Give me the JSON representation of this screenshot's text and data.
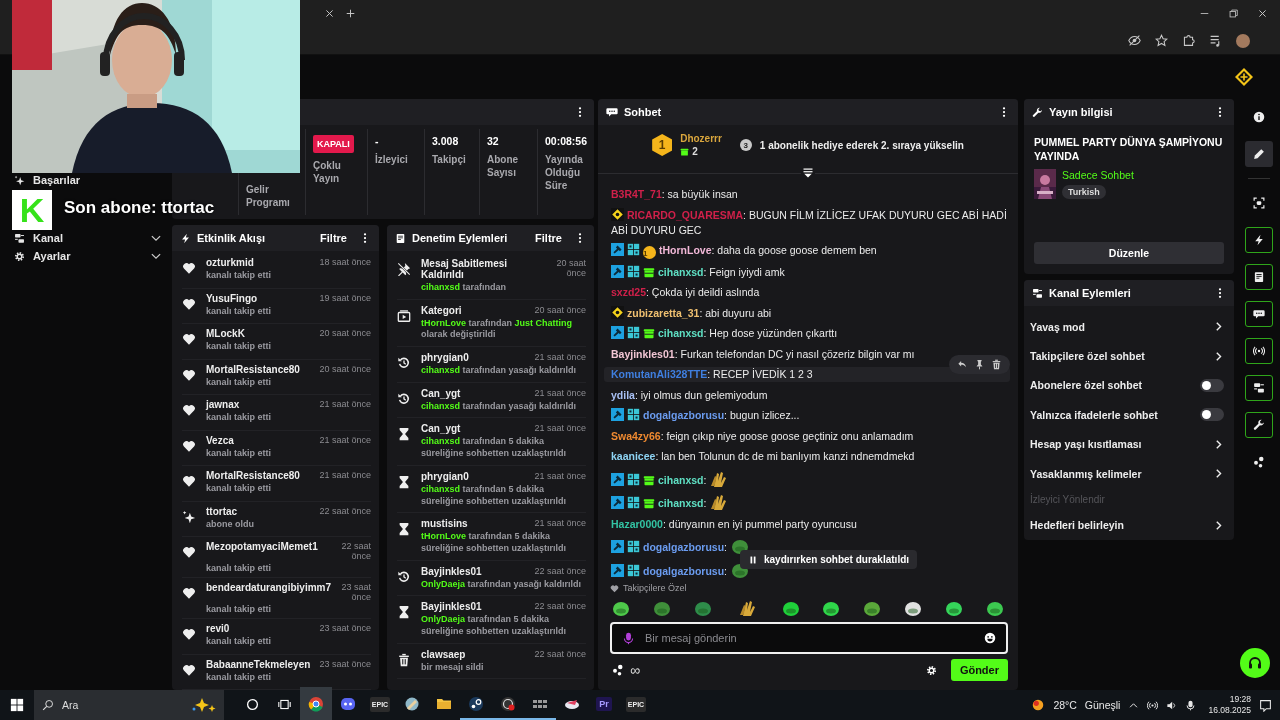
{
  "stream_overlay": {
    "logo": "K",
    "text": "Son abone: ttortac"
  },
  "sidebar": {
    "items": [
      {
        "label": "Başarılar",
        "expandable": false
      },
      {
        "label": "Kanal",
        "expandable": true
      },
      {
        "label": "Ayarlar",
        "expandable": true
      }
    ]
  },
  "stats": {
    "cells": [
      {
        "kind": "blank"
      },
      {
        "kind": "stat",
        "label": "Gelir Programı"
      },
      {
        "kind": "badge",
        "value": "KAPALI",
        "label": "Çoklu Yayın"
      },
      {
        "kind": "stat",
        "value": "-",
        "label": "İzleyici"
      },
      {
        "kind": "stat",
        "value": "3.008",
        "label": "Takipçi"
      },
      {
        "kind": "stat",
        "value": "32",
        "label": "Abone Sayısı"
      },
      {
        "kind": "stat",
        "value": "00:08:56",
        "label": "Yayında Olduğu Süre"
      }
    ]
  },
  "activity_feed": {
    "title": "Etkinlik Akışı",
    "filter": "Filtre",
    "items": [
      {
        "kind": "follow",
        "user": "ozturkmid",
        "action": "kanalı takip etti",
        "time": "18 saat önce"
      },
      {
        "kind": "follow",
        "user": "YusuFingo",
        "action": "kanalı takip etti",
        "time": "19 saat önce"
      },
      {
        "kind": "follow",
        "user": "MLockK",
        "action": "kanalı takip etti",
        "time": "20 saat önce"
      },
      {
        "kind": "follow",
        "user": "MortalResistance80",
        "action": "kanalı takip etti",
        "time": "20 saat önce"
      },
      {
        "kind": "follow",
        "user": "jawnax",
        "action": "kanalı takip etti",
        "time": "21 saat önce"
      },
      {
        "kind": "follow",
        "user": "Vezca",
        "action": "kanalı takip etti",
        "time": "21 saat önce"
      },
      {
        "kind": "follow",
        "user": "MortalResistance80",
        "action": "kanalı takip etti",
        "time": "21 saat önce"
      },
      {
        "kind": "subscribe",
        "user": "ttortac",
        "action": "abone oldu",
        "time": "22 saat önce"
      },
      {
        "kind": "follow",
        "user": "MezopotamyaciMemet1",
        "action": "kanalı takip etti",
        "time": "22 saat önce"
      },
      {
        "kind": "follow",
        "user": "bendeardaturangibiyimm7",
        "action": "kanalı takip etti",
        "time": "23 saat önce"
      },
      {
        "kind": "follow",
        "user": "revi0",
        "action": "kanalı takip etti",
        "time": "23 saat önce"
      },
      {
        "kind": "follow",
        "user": "BabaanneTekmeleyen",
        "action": "kanalı takip etti",
        "time": "23 saat önce"
      }
    ]
  },
  "moderation": {
    "title": "Denetim Eylemleri",
    "filter": "Filtre",
    "items": [
      {
        "kind": "unpin",
        "title": "Mesaj Sabitlemesi Kaldırıldı",
        "time": "20 saat önce",
        "details": [
          {
            "kind": "link",
            "text": "cihanxsd"
          },
          {
            "kind": "text",
            "text": " tarafından"
          }
        ]
      },
      {
        "kind": "category",
        "title": "Kategori",
        "time": "20 saat önce",
        "details": [
          {
            "kind": "link",
            "text": "tHornLove"
          },
          {
            "kind": "text",
            "text": " tarafından "
          },
          {
            "kind": "link",
            "text": "Just Chatting"
          },
          {
            "kind": "text",
            "text": " olarak değiştirildi"
          }
        ]
      },
      {
        "kind": "unban",
        "title": "phrygian0",
        "time": "21 saat önce",
        "details": [
          {
            "kind": "link",
            "text": "cihanxsd"
          },
          {
            "kind": "text",
            "text": " tarafından yasağı kaldırıldı"
          }
        ]
      },
      {
        "kind": "unban",
        "title": "Can_ygt",
        "time": "21 saat önce",
        "details": [
          {
            "kind": "link",
            "text": "cihanxsd"
          },
          {
            "kind": "text",
            "text": " tarafından yasağı kaldırıldı"
          }
        ]
      },
      {
        "kind": "timeout",
        "title": "Can_ygt",
        "time": "21 saat önce",
        "details": [
          {
            "kind": "link",
            "text": "cihanxsd"
          },
          {
            "kind": "text",
            "text": " tarafından 5 dakika süreliğine sohbetten uzaklaştırıldı"
          }
        ]
      },
      {
        "kind": "timeout",
        "title": "phrygian0",
        "time": "21 saat önce",
        "details": [
          {
            "kind": "link",
            "text": "cihanxsd"
          },
          {
            "kind": "text",
            "text": " tarafından 5 dakika süreliğine sohbetten uzaklaştırıldı"
          }
        ]
      },
      {
        "kind": "timeout",
        "title": "mustisins",
        "time": "21 saat önce",
        "details": [
          {
            "kind": "link",
            "text": "tHornLove"
          },
          {
            "kind": "text",
            "text": " tarafından 5 dakika süreliğine sohbetten uzaklaştırıldı"
          }
        ]
      },
      {
        "kind": "unban",
        "title": "Bayjinkles01",
        "time": "22 saat önce",
        "details": [
          {
            "kind": "link",
            "text": "OnlyDaeja"
          },
          {
            "kind": "text",
            "text": " tarafından yasağı kaldırıldı"
          }
        ]
      },
      {
        "kind": "timeout",
        "title": "Bayjinkles01",
        "time": "22 saat önce",
        "details": [
          {
            "kind": "link",
            "text": "OnlyDaeja"
          },
          {
            "kind": "text",
            "text": " tarafından 5 dakika süreliğine sohbetten uzaklaştırıldı"
          }
        ]
      },
      {
        "kind": "delete",
        "title": "clawsaep",
        "time": "22 saat önce",
        "details": [
          {
            "kind": "text",
            "text": "bir mesajı sildi"
          }
        ]
      }
    ]
  },
  "chat": {
    "title": "Sohbet",
    "leader": {
      "rank": "1",
      "user": "Dhozerrr",
      "gifts": "2",
      "next_rank": "3",
      "prompt": "1 abonelik hediye ederek 2. sıraya yükselin"
    },
    "messages": [
      {
        "user": "B3R4T_71",
        "color": "#d0204a",
        "kind": "text",
        "text": ": sa büyük insan",
        "hovered": false
      },
      {
        "user": "RICARDO_QUARESMA",
        "color": "#d0204a",
        "badges": [
          {
            "kind": "vip"
          }
        ],
        "kind": "text",
        "text": ": BUGUN FİLM İZLİCEZ UFAK DUYURU GEC ABİ HADİ ABİ DUYURU GEC",
        "hovered": false
      },
      {
        "user": "tHornLove",
        "color": "#f2b8d8",
        "badges": [
          {
            "kind": "moderator"
          },
          {
            "kind": "og"
          },
          {
            "kind": "subscriber",
            "label": "1"
          }
        ],
        "kind": "text",
        "text": ": daha da goose goose demem ben",
        "hovered": false
      },
      {
        "user": "cihanxsd",
        "color": "#5fe0c4",
        "badges": [
          {
            "kind": "moderator"
          },
          {
            "kind": "og"
          },
          {
            "kind": "gifter"
          }
        ],
        "kind": "text",
        "text": ": Feign iyiydi amk",
        "hovered": false
      },
      {
        "user": "sxzd25",
        "color": "#d0204a",
        "kind": "text",
        "text": ": Çokda iyi deildi aslında",
        "hovered": false
      },
      {
        "user": "zubizaretta_31",
        "color": "#f0c070",
        "badges": [
          {
            "kind": "vip"
          }
        ],
        "kind": "text",
        "text": ": abi duyuru abi",
        "hovered": false
      },
      {
        "user": "cihanxsd",
        "color": "#5fe0c4",
        "badges": [
          {
            "kind": "moderator"
          },
          {
            "kind": "og"
          },
          {
            "kind": "gifter"
          }
        ],
        "kind": "text",
        "text": ": Hep dose yüzünden çıkarttı",
        "hovered": false
      },
      {
        "user": "Bayjinkles01",
        "color": "#f2c6d4",
        "kind": "text",
        "text": ": Furkan telefondan DC yi nasıl çözeriz bilgin var mı",
        "hovered": false
      },
      {
        "user": "KomutanAli328TTE",
        "color": "#3f7fe0",
        "kind": "text",
        "text": ": RECEP İVEDİK 1 2 3",
        "hovered": true
      },
      {
        "user": "ydila",
        "color": "#a8c0f4",
        "kind": "text",
        "text": ": iyi olmus dun gelemiyodum",
        "hovered": false
      },
      {
        "user": "dogalgazborusu",
        "color": "#6b9cf0",
        "badges": [
          {
            "kind": "moderator"
          },
          {
            "kind": "og"
          }
        ],
        "kind": "text",
        "text": ": bugun izlicez...",
        "hovered": false
      },
      {
        "user": "Swa4zy66",
        "color": "#f08a30",
        "kind": "text",
        "text": ": feign çıkıp niye goose goose geçtiniz onu anlamadım",
        "hovered": false
      },
      {
        "user": "kaanicee",
        "color": "#8ed4f4",
        "kind": "text",
        "text": ": lan ben Tolunun dc de mi banlıyım kanzi ndnemdmekd",
        "hovered": false
      },
      {
        "user": "cihanxsd",
        "color": "#5fe0c4",
        "badges": [
          {
            "kind": "moderator"
          },
          {
            "kind": "og"
          },
          {
            "kind": "gifter"
          }
        ],
        "kind": "emote",
        "text": ":",
        "hovered": false
      },
      {
        "user": "cihanxsd",
        "color": "#5fe0c4",
        "badges": [
          {
            "kind": "moderator"
          },
          {
            "kind": "og"
          },
          {
            "kind": "gifter"
          }
        ],
        "kind": "emote",
        "text": ":",
        "hovered": false
      },
      {
        "user": "Hazar0000",
        "color": "#33c4a4",
        "kind": "text",
        "text": ": dünyaının en iyi pummel party oyuncusu",
        "hovered": false
      },
      {
        "user": "dogalgazborusu",
        "color": "#6b9cf0",
        "badges": [
          {
            "kind": "moderator"
          },
          {
            "kind": "og"
          }
        ],
        "kind": "emote",
        "text": ":",
        "hovered": false
      },
      {
        "user": "dogalgazborusu",
        "color": "#6b9cf0",
        "badges": [
          {
            "kind": "moderator"
          },
          {
            "kind": "og"
          }
        ],
        "kind": "emote",
        "text": ":",
        "hovered": false
      }
    ],
    "paused_notice": "kaydırırken sohbet duraklatıldı",
    "emote_bar_label": "Takipçilere Özel",
    "input": {
      "placeholder": "Bir mesaj gönderin"
    },
    "infinity": "∞",
    "send": "Gönder"
  },
  "stream_info": {
    "title": "Yayın bilgisi",
    "stream_title": "PUMMEL PARTY DÜNYA ŞAMPİYONU YAYINDA",
    "category": "Sadece Sohbet",
    "tags": [
      "Turkish"
    ],
    "edit": "Düzenle"
  },
  "channel_actions": {
    "title": "Kanal Eylemleri",
    "items": [
      {
        "kind": "link",
        "label": "Yavaş mod"
      },
      {
        "kind": "link",
        "label": "Takipçilere özel sohbet"
      },
      {
        "kind": "toggle",
        "label": "Abonelere özel sohbet",
        "on": false
      },
      {
        "kind": "toggle",
        "label": "Yalnızca ifadelerle sohbet",
        "on": false
      },
      {
        "kind": "link",
        "label": "Hesap yaşı kısıtlaması"
      },
      {
        "kind": "link",
        "label": "Yasaklanmış kelimeler"
      },
      {
        "kind": "heading",
        "label": "İzleyici Yönlendir"
      },
      {
        "kind": "link",
        "label": "Hedefleri belirleyin"
      }
    ]
  },
  "rail": {
    "items": [
      {
        "selected": false,
        "outlined": false
      },
      {
        "selected": true,
        "outlined": false
      },
      {
        "selected": false,
        "outlined": false
      },
      {
        "selected": false,
        "outlined": true
      },
      {
        "selected": false,
        "outlined": true
      },
      {
        "selected": false,
        "outlined": true
      },
      {
        "selected": false,
        "outlined": true
      },
      {
        "selected": false,
        "outlined": true
      },
      {
        "selected": false,
        "outlined": true
      },
      {
        "selected": false,
        "outlined": false
      }
    ]
  },
  "taskbar": {
    "search": "Ara",
    "apps": [
      {
        "running": true,
        "active": true
      },
      {
        "running": false,
        "active": false
      },
      {
        "running": false,
        "active": false,
        "label": "EPIC"
      },
      {
        "running": false,
        "active": false
      },
      {
        "running": false,
        "active": false
      },
      {
        "running": true,
        "active": false
      },
      {
        "running": true,
        "active": false
      },
      {
        "running": true,
        "active": false
      },
      {
        "running": false,
        "active": false
      },
      {
        "running": false,
        "active": false,
        "label": "Pr"
      },
      {
        "running": false,
        "active": false,
        "label": "EPIC"
      }
    ],
    "weather": {
      "temp": "28°C",
      "condition": "Güneşli"
    },
    "time": "19:28",
    "date": "16.08.2025"
  }
}
